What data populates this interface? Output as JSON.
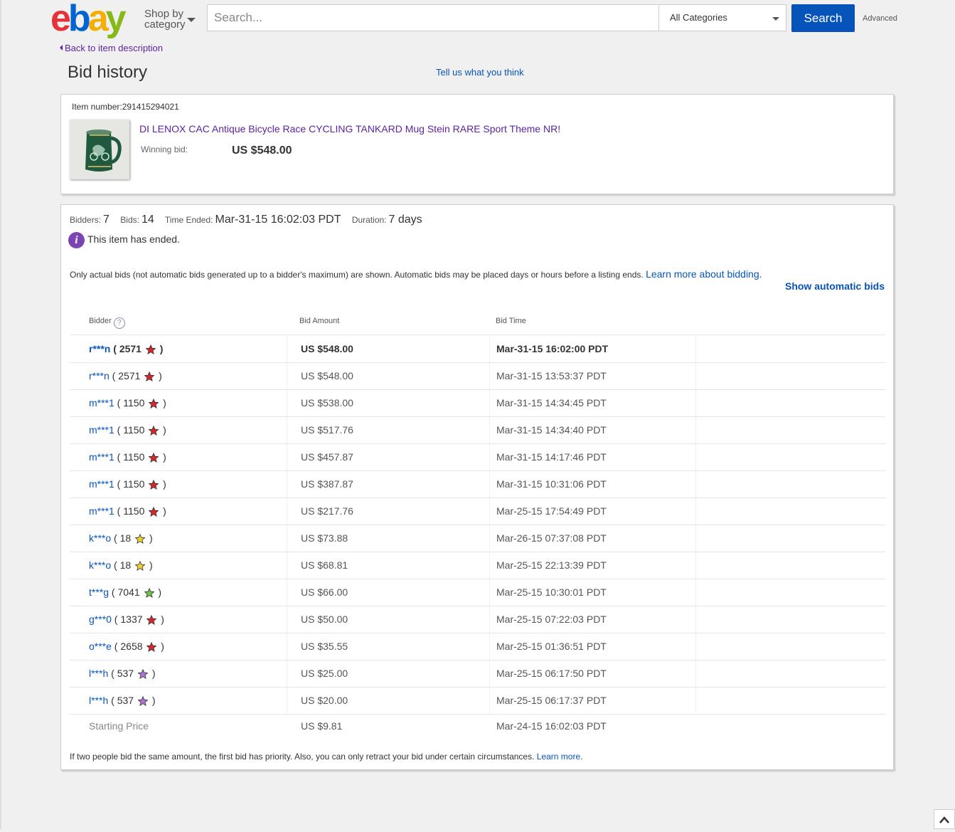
{
  "header": {
    "logo": [
      "e",
      "b",
      "a",
      "y"
    ],
    "logo_colors": [
      "#e53238",
      "#0064d2",
      "#f5af02",
      "#86b817"
    ],
    "shop_by": "Shop by",
    "category": "category",
    "search_placeholder": "Search...",
    "category_select": "All Categories",
    "search_button": "Search",
    "advanced": "Advanced"
  },
  "nav": {
    "back_link": "Back to item description",
    "page_title": "Bid history",
    "feedback_link": "Tell us what you think"
  },
  "item": {
    "number_label": "Item number:",
    "number": "291415294021",
    "title": "DI LENOX CAC Antique Bicycle Race CYCLING TANKARD Mug Stein RARE Sport Theme NR!",
    "winning_label": "Winning bid:",
    "winning_value": "US $548.00"
  },
  "summary": {
    "bidders_label": "Bidders:",
    "bidders": "7",
    "bids_label": "Bids:",
    "bids": "14",
    "time_ended_label": "Time Ended:",
    "time_ended": "Mar-31-15 16:02:03 PDT",
    "duration_label": "Duration:",
    "duration": "7 days",
    "ended_text": "This item has ended.",
    "note": "Only actual bids (not automatic bids generated up to a bidder's maximum) are shown. Automatic bids may be placed days or hours before a listing ends.",
    "learn_more_bidding": "Learn more about bidding.",
    "show_automatic": "Show automatic bids"
  },
  "table": {
    "headers": {
      "bidder": "Bidder",
      "help": "?",
      "amount": "Bid Amount",
      "time": "Bid Time"
    },
    "rows": [
      {
        "bidder": "r***n",
        "score": "2571",
        "star": "#d8252a",
        "amount": "US $548.00",
        "time": "Mar-31-15 16:02:00 PDT"
      },
      {
        "bidder": "r***n",
        "score": "2571",
        "star": "#d8252a",
        "amount": "US $548.00",
        "time": "Mar-31-15 13:53:37 PDT"
      },
      {
        "bidder": "m***1",
        "score": "1150",
        "star": "#d8252a",
        "amount": "US $538.00",
        "time": "Mar-31-15 14:34:45 PDT"
      },
      {
        "bidder": "m***1",
        "score": "1150",
        "star": "#d8252a",
        "amount": "US $517.76",
        "time": "Mar-31-15 14:34:40 PDT"
      },
      {
        "bidder": "m***1",
        "score": "1150",
        "star": "#d8252a",
        "amount": "US $457.87",
        "time": "Mar-31-15 14:17:46 PDT"
      },
      {
        "bidder": "m***1",
        "score": "1150",
        "star": "#d8252a",
        "amount": "US $387.87",
        "time": "Mar-31-15 10:31:06 PDT"
      },
      {
        "bidder": "m***1",
        "score": "1150",
        "star": "#d8252a",
        "amount": "US $217.76",
        "time": "Mar-25-15 17:54:49 PDT"
      },
      {
        "bidder": "k***o",
        "score": "18",
        "star": "#f4d225",
        "amount": "US $73.88",
        "time": "Mar-26-15 07:37:08 PDT"
      },
      {
        "bidder": "k***o",
        "score": "18",
        "star": "#f4d225",
        "amount": "US $68.81",
        "time": "Mar-25-15 22:13:39 PDT"
      },
      {
        "bidder": "t***g",
        "score": "7041",
        "star": "#6fc24b",
        "amount": "US $66.00",
        "time": "Mar-25-15 10:30:01 PDT"
      },
      {
        "bidder": "g***0",
        "score": "1337",
        "star": "#d8252a",
        "amount": "US $50.00",
        "time": "Mar-25-15 07:22:03 PDT"
      },
      {
        "bidder": "o***e",
        "score": "2658",
        "star": "#d8252a",
        "amount": "US $35.55",
        "time": "Mar-25-15 01:36:51 PDT"
      },
      {
        "bidder": "l***h",
        "score": "537",
        "star": "#b072d8",
        "amount": "US $25.00",
        "time": "Mar-25-15 06:17:50 PDT"
      },
      {
        "bidder": "l***h",
        "score": "537",
        "star": "#b072d8",
        "amount": "US $20.00",
        "time": "Mar-25-15 06:17:37 PDT"
      }
    ],
    "starting": {
      "label": "Starting Price",
      "amount": "US $9.81",
      "time": "Mar-24-15 16:02:03 PDT"
    }
  },
  "footer": {
    "note": "If two people bid the same amount, the first bid has priority. Also, you can only retract your bid under certain circumstances.",
    "learn_more": "Learn more."
  },
  "colors": {
    "link": "#0654ba",
    "visited": "#5d23a0",
    "search_button": "#0654ba"
  }
}
